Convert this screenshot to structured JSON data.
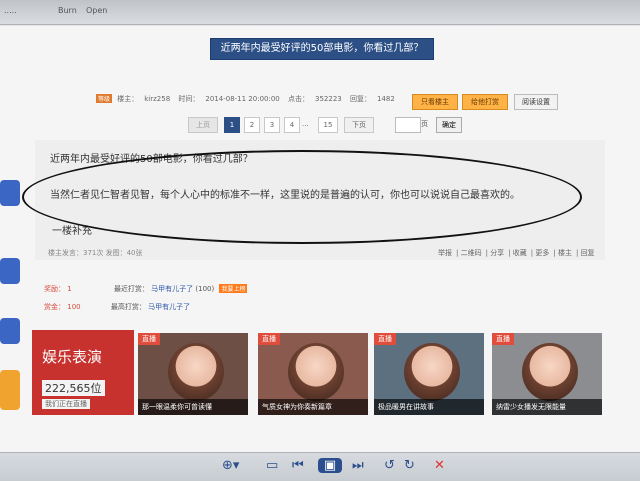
{
  "window": {
    "menu_items": [
      ".....",
      "Burn",
      "Open"
    ]
  },
  "post_header": {
    "title": "近两年内最受好评的50部电影，你看过几部？",
    "lv_badge": "等级",
    "author_label": "楼主：",
    "author_value": "kirz258",
    "time_label": "时间：",
    "time_value": "2014-08-11 20:00:00",
    "hits_label": "点击：",
    "hits_value": "352223",
    "replies_label": "回复：",
    "replies_value": "1482",
    "only_op_btn": "只看楼主",
    "tip_btn": "给他打赏",
    "reading_btn": "阅读设置"
  },
  "pagination": {
    "prev": "上页",
    "pages": [
      "1",
      "2",
      "3",
      "4",
      "...",
      "15"
    ],
    "next": "下页",
    "page_label": "页",
    "confirm": "确定"
  },
  "post_body": {
    "title": "近两年内最受好评的50部电影，你看过几部？",
    "body": "当然仁者见仁智者见智，每个人心中的标准不一样，这里说的是普遍的认可，你也可以说说自己最喜欢的。",
    "signature": "一楼补充"
  },
  "stats": {
    "text": "楼主发言：371次 发图：40张"
  },
  "actions": [
    "举报",
    "二维码",
    "分享",
    "收藏",
    "更多",
    "楼主",
    "回复"
  ],
  "reward_rows": [
    {
      "label": "奖励：",
      "value": "1",
      "recent_label": "最近打赏：",
      "recent_user": "马甲有儿子了",
      "recent_amount": "(100)",
      "tag": "我要上榜"
    },
    {
      "label": "赏金：",
      "value": "100",
      "recent_label": "最高打赏：",
      "recent_user": "马甲有儿子了",
      "recent_amount": ""
    }
  ],
  "entertainment": {
    "title": "娱乐表演",
    "count": "222,565位",
    "subtitle": "我们正在直播"
  },
  "live_cards": [
    {
      "badge": "直播",
      "caption": "那一眼温柔你可曾读懂"
    },
    {
      "badge": "直播",
      "caption": "气质女神为你奏新篇章"
    },
    {
      "badge": "直播",
      "caption": "极品暖男在讲故事"
    },
    {
      "badge": "直播",
      "caption": "纳雷少女播发无限能量"
    }
  ],
  "colors": {
    "nav_blue": "#2c4f86",
    "accent_red": "#c8322e",
    "accent_orange": "#ffb347"
  }
}
